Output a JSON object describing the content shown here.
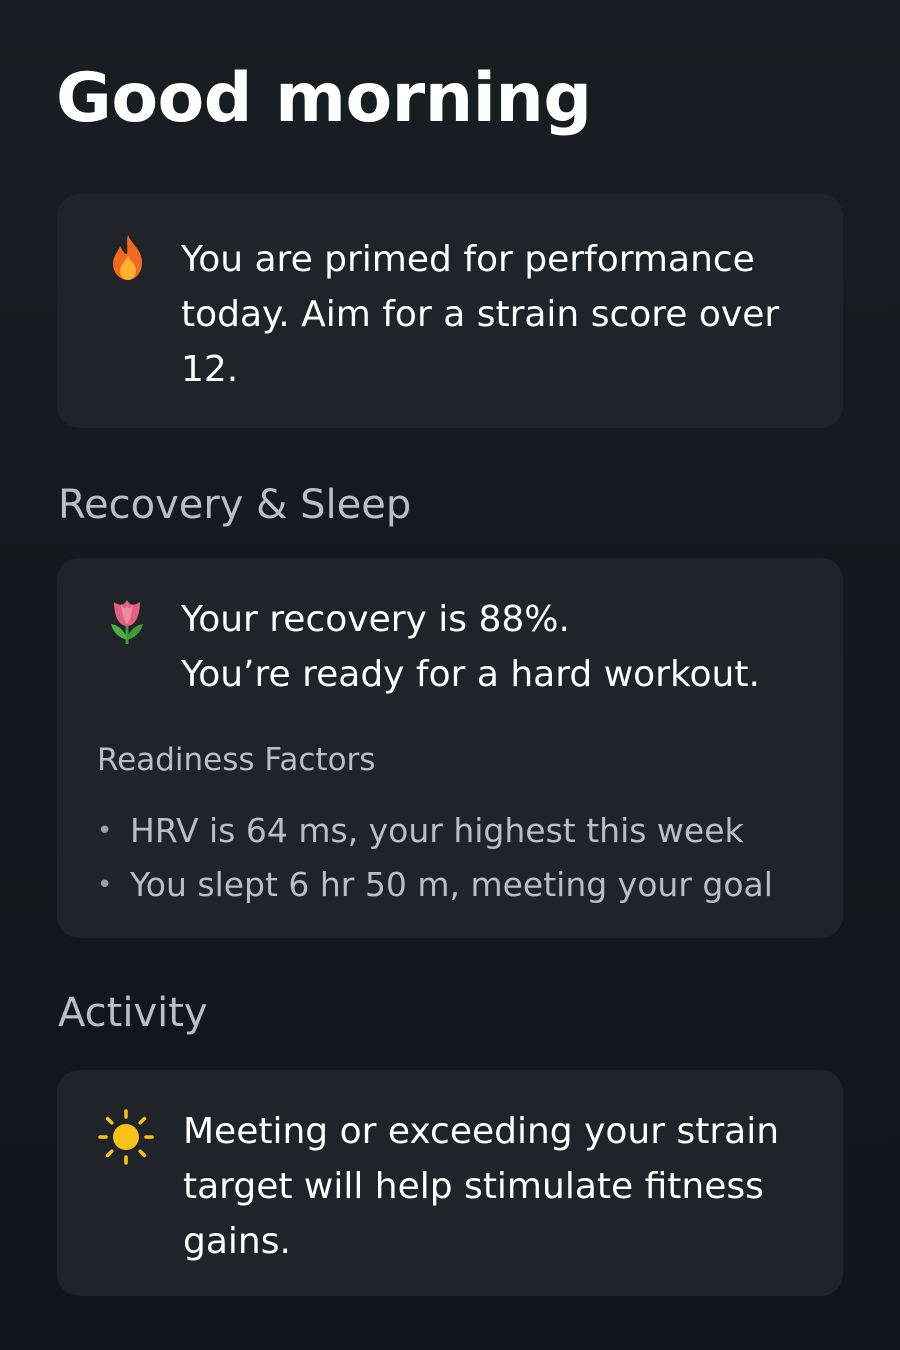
{
  "header": {
    "greeting": "Good morning"
  },
  "insight_card": {
    "icon": "fire-icon",
    "text": "You are primed for performance today. Aim for a strain score over 12."
  },
  "recovery_section": {
    "title": "Recovery & Sleep",
    "card": {
      "icon": "tulip-icon",
      "line1": "Your recovery is 88%.",
      "line2": "You’re ready for a hard workout.",
      "factors_title": "Readiness Factors",
      "factors": [
        "HRV is 64 ms, your highest this week",
        "You slept 6 hr 50 m, meeting your goal"
      ]
    }
  },
  "activity_section": {
    "title": "Activity",
    "card": {
      "icon": "sun-icon",
      "text": "Meeting or exceeding your strain target will help stimulate fitness gains."
    }
  },
  "colors": {
    "background": "#14171b",
    "card": "#202429",
    "primary_text": "#ffffff",
    "secondary_text": "#b9bec4",
    "fire": "#f26a21",
    "tulip": "#e0607e",
    "sun": "#f7c21b"
  }
}
